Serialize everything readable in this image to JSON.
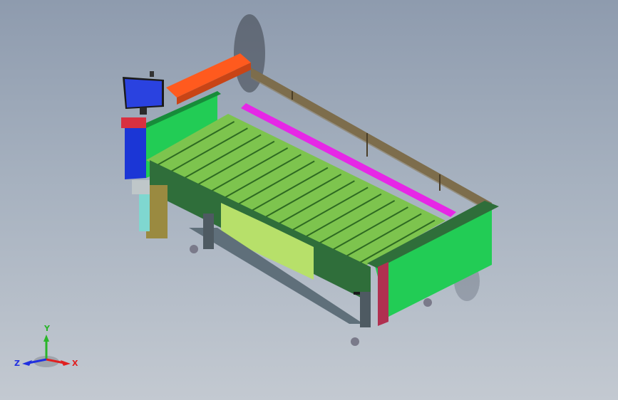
{
  "viewport": {
    "background_top": "#8e9bae",
    "background_bottom": "#c3c9d1"
  },
  "model": {
    "colors": {
      "top_rail": "#ff5a1e",
      "end_panel": "#22cc55",
      "end_panel_dark": "#178c3a",
      "tray": "#7dc44e",
      "tray_edge": "#2e6a22",
      "frame_green": "#2f6e3a",
      "pale_panel": "#b7e06a",
      "magenta_rail": "#e627e6",
      "rear_frame": "#6a5a3a",
      "blue_part": "#1b36d6",
      "monitor_blue": "#2a42e0",
      "red_cap": "#d83040",
      "pink_post": "#b03050",
      "steel": "#5f6f7a",
      "wheel": "#7a7a8a"
    },
    "icons": [
      "monitor-icon",
      "wheel-icon"
    ]
  },
  "axis_triad": {
    "y_label": "Y",
    "x_label": "X",
    "z_label": "Z",
    "y_color": "#2ab52a",
    "x_color": "#e02020",
    "z_color": "#2030e0"
  }
}
